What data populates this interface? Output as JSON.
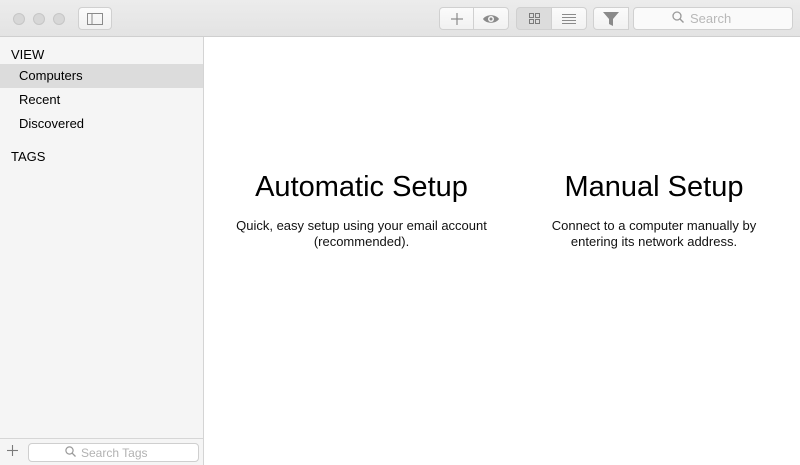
{
  "toolbar": {
    "search_placeholder": "Search",
    "icons": {
      "sidebar_toggle": "sidebar-toggle-icon",
      "add": "plus-icon",
      "preview": "eye-icon",
      "grid": "grid-view-icon",
      "list": "list-view-icon",
      "filter": "filter-icon",
      "search": "search-icon"
    }
  },
  "sidebar": {
    "view_header": "VIEW",
    "items": [
      {
        "label": "Computers",
        "selected": true
      },
      {
        "label": "Recent",
        "selected": false
      },
      {
        "label": "Discovered",
        "selected": false
      }
    ],
    "tags_header": "TAGS",
    "footer": {
      "search_placeholder": "Search Tags"
    }
  },
  "main": {
    "automatic": {
      "title": "Automatic Setup",
      "description": "Quick, easy setup using your email account (recommended)."
    },
    "manual": {
      "title": "Manual Setup",
      "description": "Connect to a computer manually by entering its network address."
    }
  },
  "colors": {
    "toolbar_bg": "#e6e6e6",
    "sidebar_bg": "#f5f5f5",
    "selected_item_bg": "#dcdcdc",
    "icon_gray": "#8a8a8a"
  }
}
